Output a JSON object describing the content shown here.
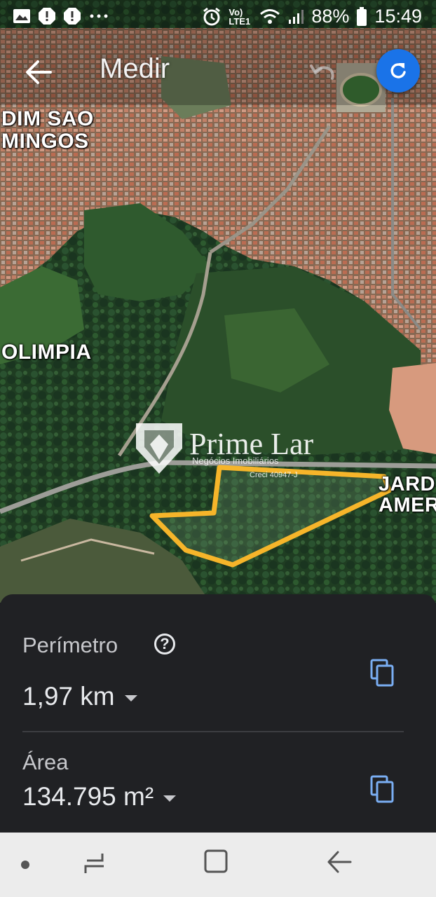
{
  "status_bar": {
    "battery": "88%",
    "time": "15:49",
    "network": "Vo) LTE1",
    "icons": [
      "image-icon",
      "alert-icon",
      "alert-icon",
      "more-dots-icon",
      "alarm-icon",
      "volte-icon",
      "wifi-icon",
      "signal-icon",
      "battery-icon"
    ]
  },
  "app_bar": {
    "title": "Medir",
    "back_icon": "arrow-back-icon",
    "undo_icon": "undo-icon",
    "reset_icon": "refresh-icon",
    "accent": "#1a73e8"
  },
  "map": {
    "labels": {
      "sao_domingos": "DIM SAO\nMINGOS",
      "olimpia": "OLIMPIA",
      "jardim_america": "JARD\nAMER"
    },
    "measure_line_color": "#f6b52a"
  },
  "watermark": {
    "name": "Prime Lar",
    "subtitle": "Negócios Imobiliários",
    "creci": "Creci 40947-J"
  },
  "measurement_panel": {
    "perimeter_label": "Perímetro",
    "perimeter_value": "1,97 km",
    "area_label": "Área",
    "area_value": "134.795 m²",
    "help_icon": "help-circle-icon",
    "copy_icon": "copy-icon"
  },
  "nav_bar": {
    "items": [
      "dot-icon",
      "recent-apps-icon",
      "home-icon",
      "back-icon"
    ]
  }
}
